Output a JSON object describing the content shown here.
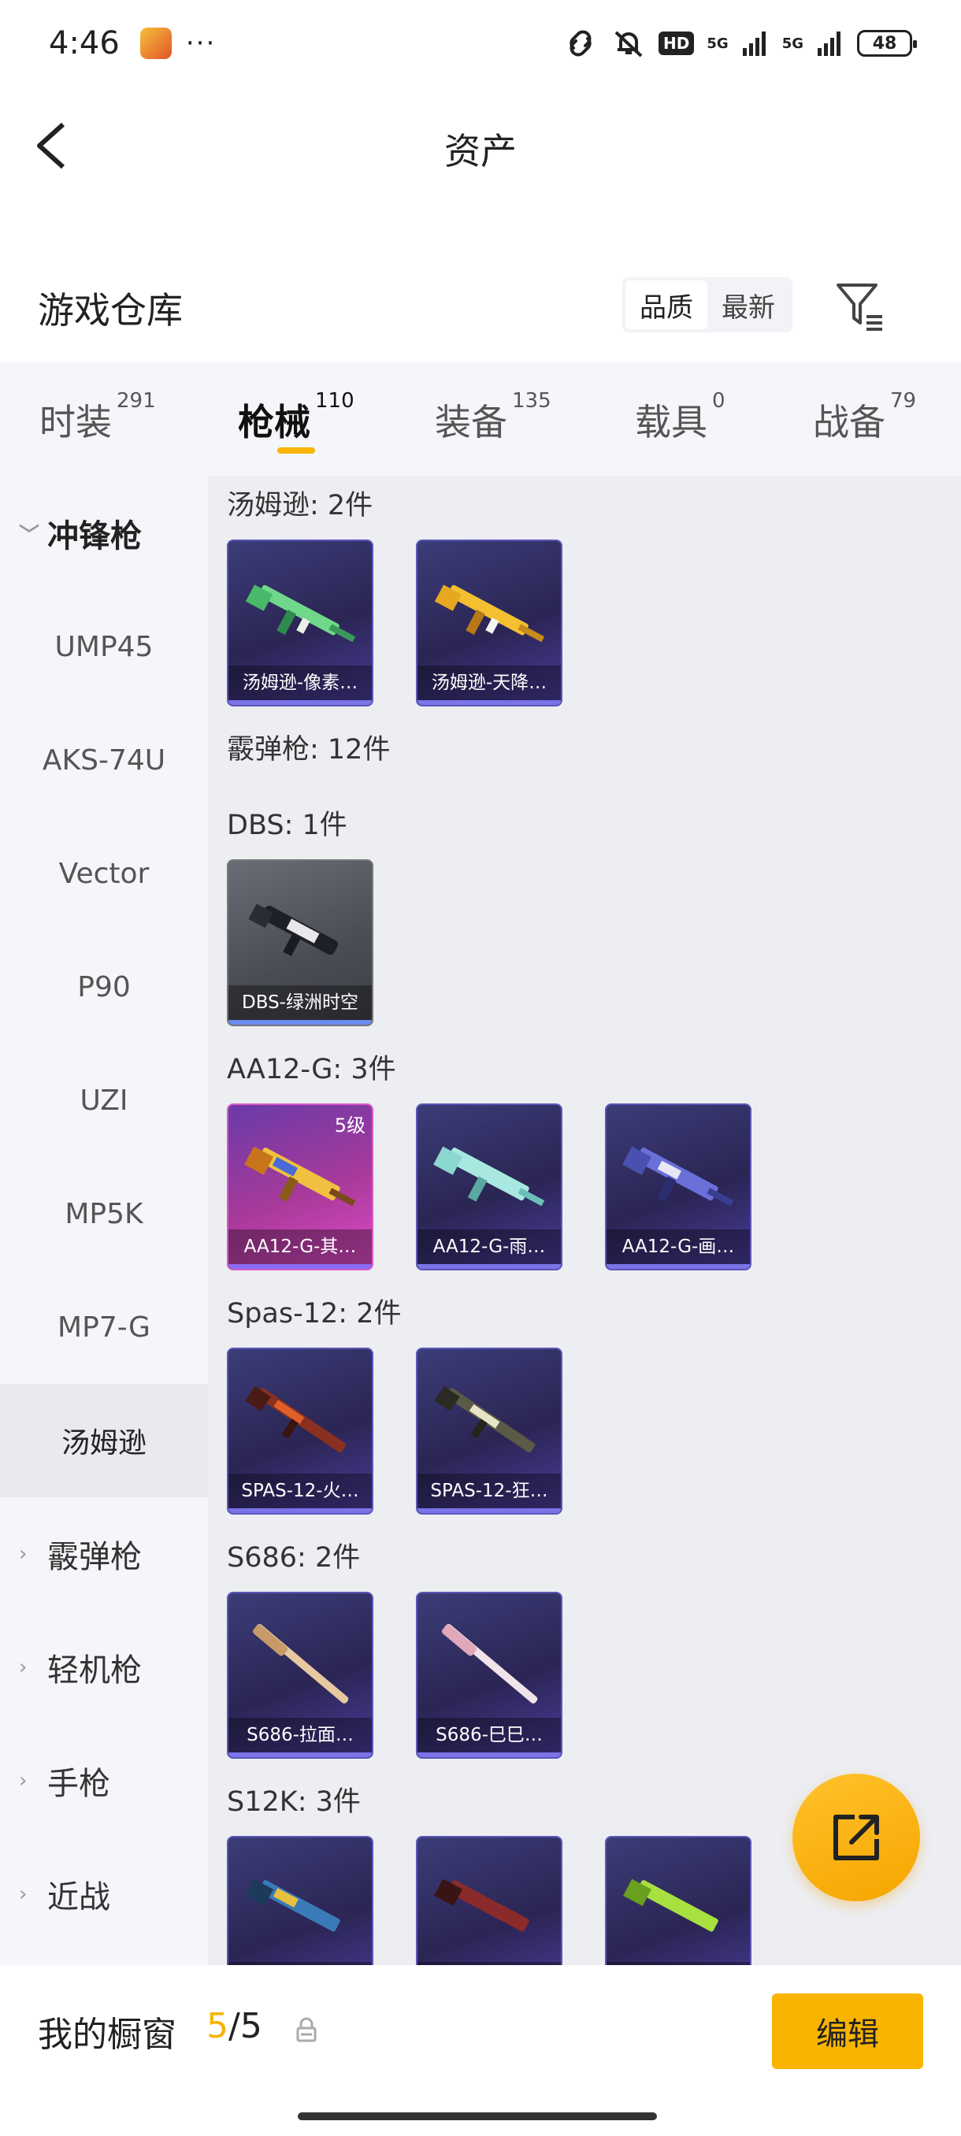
{
  "status_bar": {
    "time": "4:46",
    "dots": "···",
    "hd": "HD",
    "signal1": "5G",
    "signal2": "5G",
    "battery": "48"
  },
  "header": {
    "title": "资产"
  },
  "section": {
    "title": "游戏仓库",
    "sort_quality": "品质",
    "sort_newest": "最新"
  },
  "tabs": [
    {
      "label": "时装",
      "count": "291"
    },
    {
      "label": "枪械",
      "count": "110"
    },
    {
      "label": "装备",
      "count": "135"
    },
    {
      "label": "载具",
      "count": "0"
    },
    {
      "label": "战备",
      "count": "79"
    }
  ],
  "sidebar": {
    "group_open": "冲锋枪",
    "subitems": [
      "UMP45",
      "AKS-74U",
      "Vector",
      "P90",
      "UZI",
      "MP5K",
      "MP7-G",
      "汤姆逊"
    ],
    "groups": [
      "霰弹枪",
      "轻机枪",
      "手枪",
      "近战"
    ]
  },
  "content": {
    "groups": [
      {
        "label": "汤姆逊: 2件",
        "cards": [
          {
            "name": "汤姆逊-像素…"
          },
          {
            "name": "汤姆逊-天降…"
          }
        ]
      },
      {
        "label": "霰弹枪: 12件",
        "cards": []
      },
      {
        "label": "DBS: 1件",
        "cards": [
          {
            "name": "DBS-绿洲时空"
          }
        ]
      },
      {
        "label": "AA12-G: 3件",
        "cards": [
          {
            "name": "AA12-G-其…",
            "level": "5级"
          },
          {
            "name": "AA12-G-雨…"
          },
          {
            "name": "AA12-G-画…"
          }
        ]
      },
      {
        "label": "Spas-12: 2件",
        "cards": [
          {
            "name": "SPAS-12-火…"
          },
          {
            "name": "SPAS-12-狂…"
          }
        ]
      },
      {
        "label": "S686: 2件",
        "cards": [
          {
            "name": "S686-拉面…"
          },
          {
            "name": "S686-巳巳…"
          }
        ]
      },
      {
        "label": "S12K: 3件",
        "cards": [
          {
            "name": ""
          },
          {
            "name": ""
          },
          {
            "name": ""
          }
        ]
      }
    ]
  },
  "bottom": {
    "showcase_label": "我的橱窗",
    "showcase_current": "5",
    "showcase_total": "/5",
    "edit_label": "编辑"
  },
  "colors": {
    "accent": "#f8b400",
    "card_purple": "#2b2554",
    "card_pink": "#a83a9a"
  }
}
